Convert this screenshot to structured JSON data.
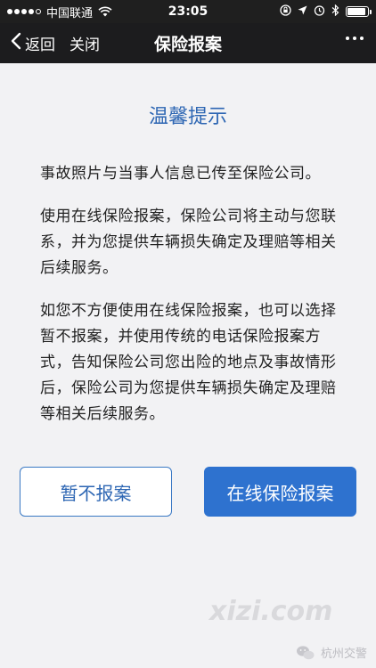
{
  "status_bar": {
    "carrier": "中国联通",
    "time": "23:05"
  },
  "nav": {
    "back_label": "返回",
    "close_label": "关闭",
    "title": "保险报案"
  },
  "notice": {
    "title": "温馨提示",
    "paragraphs": [
      "事故照片与当事人信息已传至保险公司。",
      "使用在线保险报案，保险公司将主动与您联系，并为您提供车辆损失确定及理赔等相关后续服务。",
      "如您不方便使用在线保险报案，也可以选择暂不报案，并使用传统的电话保险报案方式，告知保险公司您出险的地点及事故情形后，保险公司为您提供车辆损失确定及理赔等相关后续服务。"
    ]
  },
  "buttons": {
    "decline": "暂不报案",
    "online": "在线保险报案"
  },
  "watermark": {
    "site": "xizi.com",
    "account": "杭州交警"
  },
  "colors": {
    "accent": "#2e72cf",
    "title_blue": "#2d66b3",
    "nav_bg": "#1c1c1e",
    "content_bg": "#f2f2f4"
  }
}
